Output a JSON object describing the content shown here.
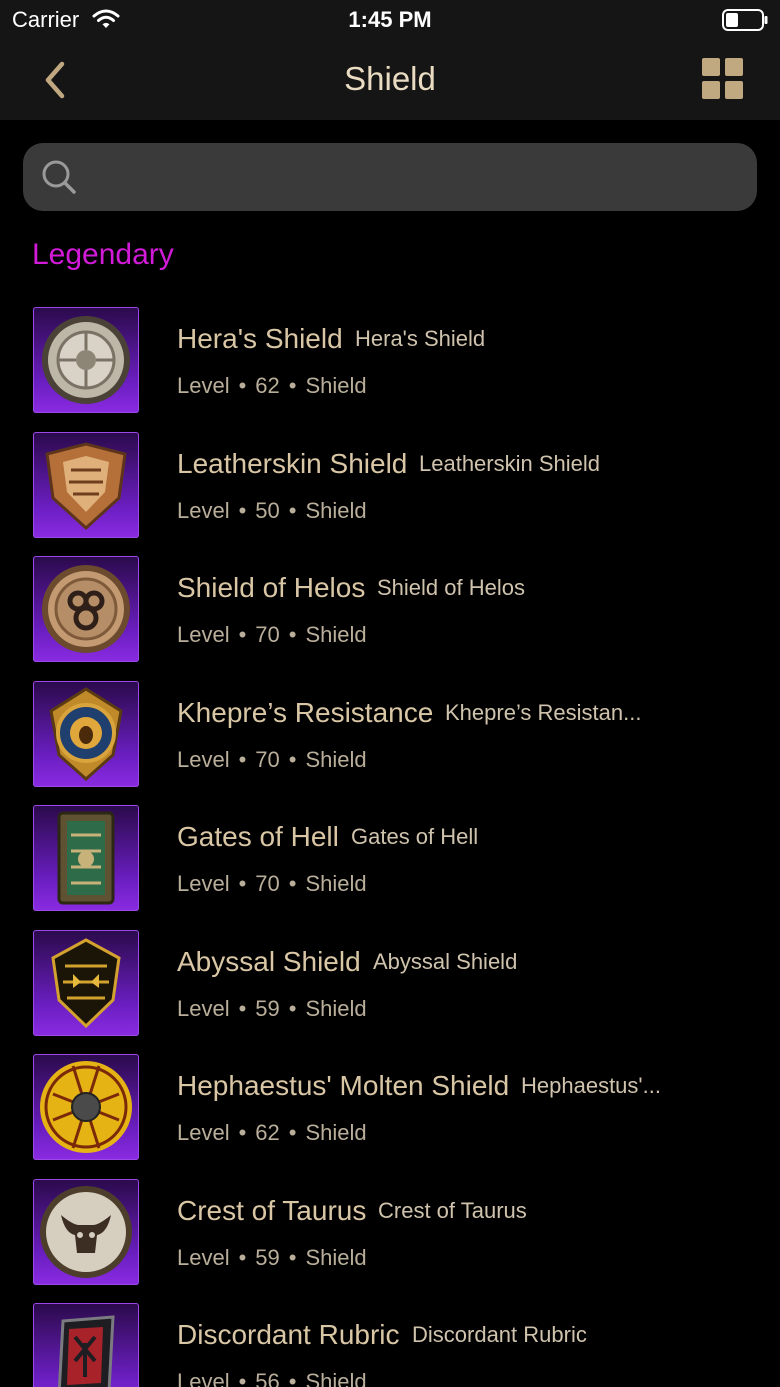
{
  "status_bar": {
    "carrier": "Carrier",
    "time": "1:45 PM"
  },
  "nav": {
    "title": "Shield"
  },
  "search": {
    "placeholder": ""
  },
  "section": {
    "title": "Legendary"
  },
  "meta_template": {
    "level_label": "Level",
    "separator": "•"
  },
  "items": [
    {
      "name": "Hera's Shield",
      "subtitle": "Hera's Shield",
      "level": "62",
      "type": "Shield",
      "icon": "round-silver-shield-icon"
    },
    {
      "name": "Leatherskin Shield",
      "subtitle": "Leatherskin Shield",
      "level": "50",
      "type": "Shield",
      "icon": "leather-shield-icon"
    },
    {
      "name": "Shield of Helos",
      "subtitle": "Shield of Helos",
      "level": "70",
      "type": "Shield",
      "icon": "bronze-round-shield-icon"
    },
    {
      "name": "Khepre’s Resistance",
      "subtitle": "Khepre’s Resistan...",
      "level": "70",
      "type": "Shield",
      "icon": "scarab-shield-icon"
    },
    {
      "name": "Gates of Hell",
      "subtitle": "Gates of Hell",
      "level": "70",
      "type": "Shield",
      "icon": "tower-shield-icon"
    },
    {
      "name": "Abyssal Shield",
      "subtitle": "Abyssal Shield",
      "level": "59",
      "type": "Shield",
      "icon": "dark-demon-shield-icon"
    },
    {
      "name": "Hephaestus' Molten Shield",
      "subtitle": "Hephaestus'...",
      "level": "62",
      "type": "Shield",
      "icon": "molten-shield-icon"
    },
    {
      "name": "Crest of Taurus",
      "subtitle": "Crest of Taurus",
      "level": "59",
      "type": "Shield",
      "icon": "bull-crest-shield-icon"
    },
    {
      "name": "Discordant Rubric",
      "subtitle": "Discordant Rubric",
      "level": "56",
      "type": "Shield",
      "icon": "rune-shield-icon"
    }
  ],
  "colors": {
    "accent_title": "#e9dcc2",
    "legendary": "#d21bd9",
    "item_name": "#d9c6a5",
    "thumb_purple": "#6a1ec0",
    "background": "#000000",
    "bars": "#151515"
  }
}
